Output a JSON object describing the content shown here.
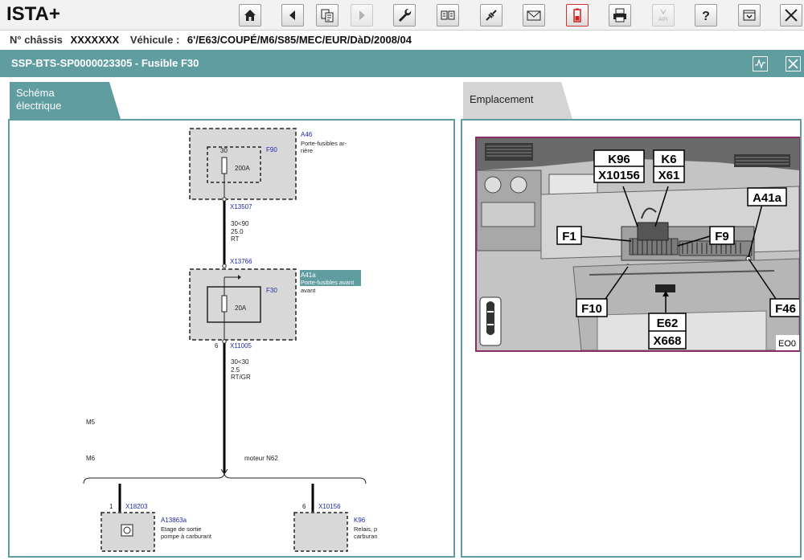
{
  "app": {
    "title": "ISTA+"
  },
  "toolbar": {
    "buttons": [
      {
        "icon": "home-icon",
        "enabled": true
      },
      {
        "icon": "back-icon",
        "enabled": true
      },
      {
        "icon": "documents-icon",
        "enabled": true
      },
      {
        "icon": "forward-icon",
        "enabled": false
      },
      {
        "icon": "wrench-icon",
        "enabled": true
      },
      {
        "icon": "compare-icon",
        "enabled": true
      },
      {
        "icon": "connection-icon",
        "enabled": true
      },
      {
        "icon": "mail-icon",
        "enabled": true
      },
      {
        "icon": "battery-icon",
        "enabled": true
      },
      {
        "icon": "print-icon",
        "enabled": true
      },
      {
        "icon": "air-icon",
        "enabled": false
      },
      {
        "icon": "help-icon",
        "enabled": true
      },
      {
        "icon": "minimize-icon",
        "enabled": true
      },
      {
        "icon": "close-icon",
        "enabled": true
      }
    ],
    "air_label": "AIR",
    "help_label": "?"
  },
  "vehicle": {
    "chassis_label": "N° châssis",
    "chassis_value": "XXXXXXX",
    "vehicle_label": "Véhicule :",
    "vehicle_value": "6'/E63/COUPÉ/M6/S85/MEC/EUR/DàD/2008/04"
  },
  "document": {
    "title": "SSP-BTS-SP0000023305  -  Fusible F30"
  },
  "tabs": {
    "schema_line1": "Schéma",
    "schema_line2": "électrique",
    "location": "Emplacement"
  },
  "schematic": {
    "a46_id": "A46",
    "a46_desc_1": "Porte-fusibles ar-",
    "a46_desc_2": "rière",
    "f90_id": "F90",
    "f90_pin": "30",
    "f90_rating": "200A",
    "x13507": "X13507",
    "wire1_1": "30<90",
    "wire1_2": "25.0",
    "wire1_3": "RT",
    "x13766": "X13766",
    "a41a_id": "A41a",
    "a41a_desc_1": "Porte-fusibles avant",
    "a41a_desc_2": "avant",
    "f30_id": "F30",
    "f30_rating": "20A",
    "pin_6": "6",
    "x11005": "X11005",
    "wire2_1": "30<30",
    "wire2_2": "2.5",
    "wire2_3": "RT/GR",
    "m5": "M5",
    "m6": "M6",
    "moteur": "moteur N62",
    "pin_1": "1",
    "x18203": "X18203",
    "a13863a_id": "A13863a",
    "a13863a_desc_1": "Etage de sortie",
    "a13863a_desc_2": "pompe à carburant",
    "pin_6b": "6",
    "x10156": "X10156",
    "k96_id": "K96",
    "k96_desc_1": "Relais, p",
    "k96_desc_2": "carburan"
  },
  "location": {
    "labels": {
      "k96": "K96",
      "x10156": "X10156",
      "k6": "K6",
      "x61": "X61",
      "a41a": "A41a",
      "f1": "F1",
      "f9": "F9",
      "f10": "F10",
      "f46": "F46",
      "e62": "E62",
      "x668": "X668",
      "code": "EO0"
    }
  },
  "colors": {
    "accent": "#5f9da0",
    "tab_inactive": "#d4d4d4",
    "link_blue": "#1d2aa8",
    "photo_frame": "#8a2e6a"
  }
}
